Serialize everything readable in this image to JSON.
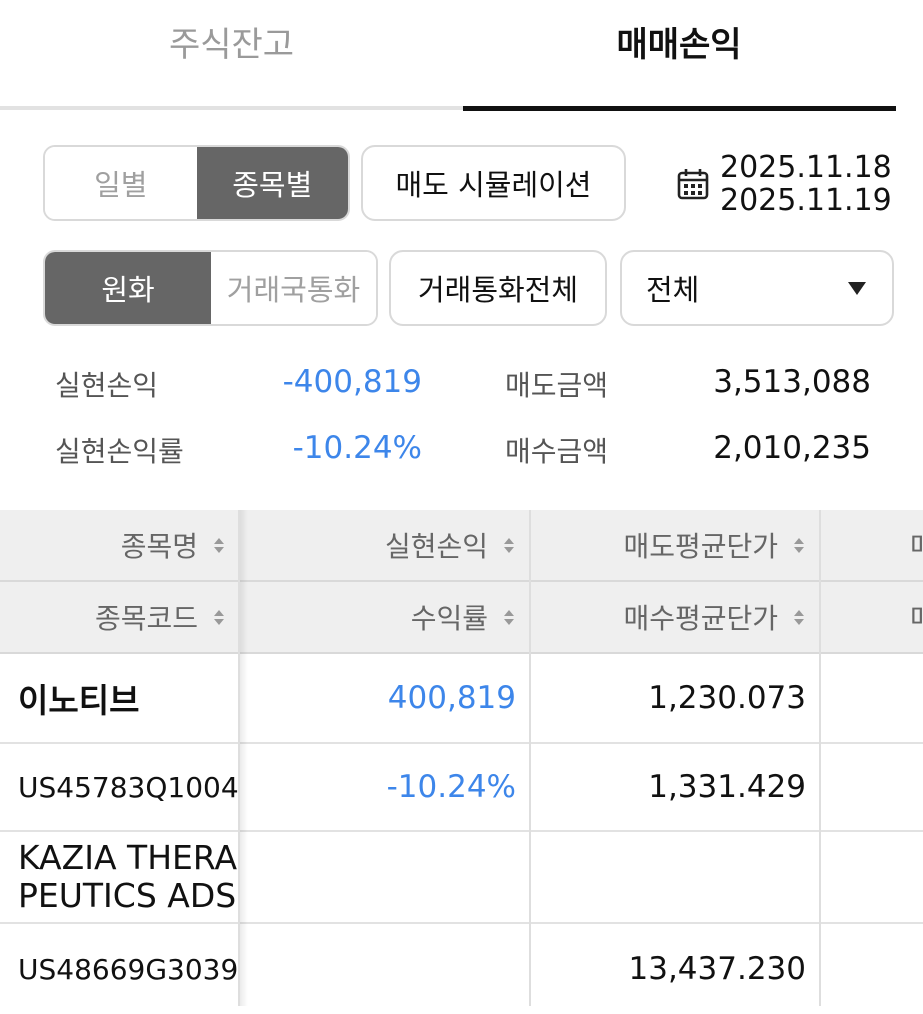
{
  "tabs": {
    "holdings": "주식잔고",
    "pnl": "매매손익"
  },
  "view_mode": {
    "daily": "일별",
    "by_stock": "종목별"
  },
  "sell_sim_button": "매도 시뮬레이션",
  "date_range": {
    "start": "2025.11.18",
    "end": "2025.11.19"
  },
  "currency_mode": {
    "krw": "원화",
    "local": "거래국통화"
  },
  "all_currency_button": "거래통화전체",
  "filter": {
    "selected": "전체"
  },
  "summary": {
    "realized_pnl_label": "실현손익",
    "realized_pnl_value": "-400,819",
    "realized_rate_label": "실현손익률",
    "realized_rate_value": "-10.24%",
    "sell_amount_label": "매도금액",
    "sell_amount_value": "3,513,088",
    "buy_amount_label": "매수금액",
    "buy_amount_value": "2,010,235"
  },
  "table": {
    "headers_row1": [
      "종목명",
      "실현손익",
      "매도평균단가",
      "매"
    ],
    "headers_row2": [
      "종목코드",
      "수익률",
      "매수평균단가",
      "매"
    ],
    "rows": [
      {
        "name": "이노티브",
        "code": "US45783Q1004",
        "pnl": "400,819",
        "rate": "-10.24%",
        "sell_avg": "1,230.073",
        "buy_avg": "1,331.429"
      },
      {
        "name_line1": "KAZIA THERA",
        "name_line2": "PEUTICS ADS",
        "code": "US48669G3039",
        "pnl": "",
        "rate": "",
        "sell_avg": "",
        "buy_avg": "13,437.230"
      }
    ]
  },
  "colors": {
    "active_bg": "#666666",
    "positive_blue": "#3d86ea",
    "header_bg": "#efefef"
  }
}
